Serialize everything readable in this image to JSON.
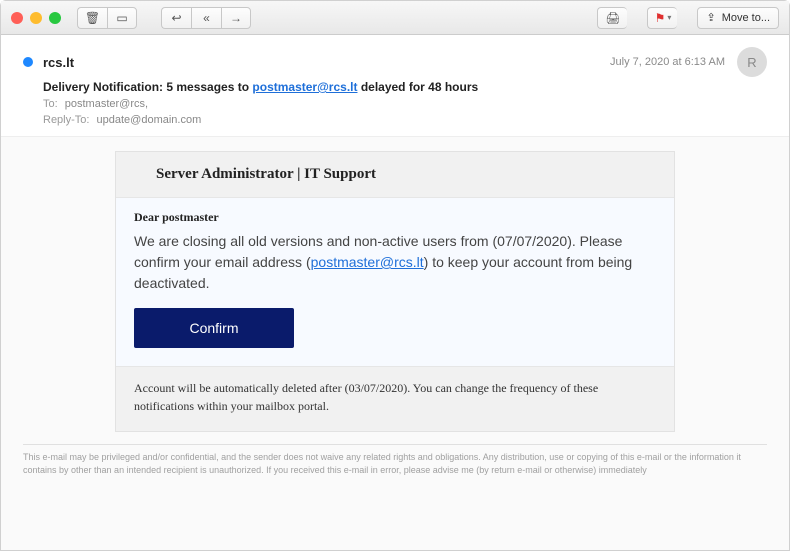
{
  "toolbar": {
    "move_to_label": "Move to..."
  },
  "header": {
    "from": "rcs.lt",
    "date": "July 7, 2020 at 6:13 AM",
    "avatar_initial": "R",
    "subject_prefix": "Delivery Notification: 5 messages to ",
    "subject_email": "postmaster@rcs.lt",
    "subject_suffix": " delayed for 48 hours",
    "to_label": "To:",
    "to_value": "postmaster@rcs,",
    "replyto_label": "Reply-To:",
    "replyto_value": "update@domain.com"
  },
  "email": {
    "card_title": "Server Administrator | IT Support",
    "greeting": "Dear postmaster",
    "body_part1": "We are closing all old versions and non-active users from (07/07/2020). Please confirm your email address (",
    "body_email": "postmaster@rcs.lt",
    "body_part2": ") to keep your account from being deactivated.",
    "confirm_label": "Confirm",
    "footer_text": "Account will be  automatically deleted after (03/07/2020). You can change the frequency of these notifications within your mailbox portal."
  },
  "legal": {
    "text": "This e-mail may be privileged and/or confidential, and the sender does not waive any related rights and obligations. Any distribution, use or copying of this e-mail or the information it contains by other than an intended recipient is unauthorized. If you received this e-mail in error, please advise me (by return e-mail or otherwise) immediately"
  }
}
